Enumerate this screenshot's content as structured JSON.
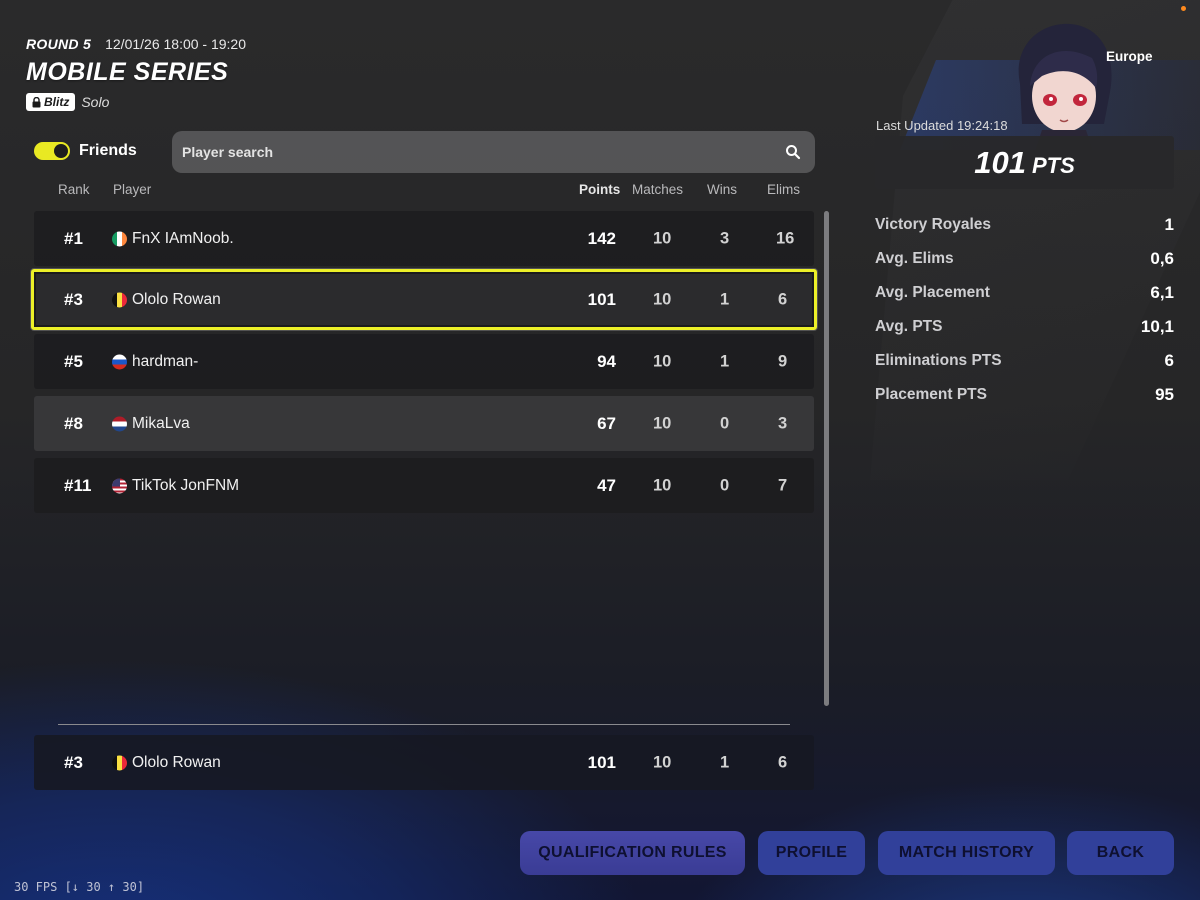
{
  "header": {
    "round": "ROUND 5",
    "time": "12/01/26 18:00 - 19:20",
    "title": "MOBILE SERIES",
    "mode_badge": "Blitz",
    "mode_type": "Solo"
  },
  "filters": {
    "friends_label": "Friends",
    "friends_enabled": true,
    "search_placeholder": "Player search",
    "accent_color": "#e9e923"
  },
  "table": {
    "columns": {
      "rank": "Rank",
      "player": "Player",
      "points": "Points",
      "matches": "Matches",
      "wins": "Wins",
      "elims": "Elims"
    },
    "rows": [
      {
        "rank": "#1",
        "flag": "ireland-flag",
        "name": "FnX IAmNoob.",
        "points": "142",
        "matches": "10",
        "wins": "3",
        "elims": "16"
      },
      {
        "rank": "#3",
        "flag": "belgium-flag",
        "name": "Ololo Rowan",
        "points": "101",
        "matches": "10",
        "wins": "1",
        "elims": "6"
      },
      {
        "rank": "#5",
        "flag": "russia-flag",
        "name": "hardman-",
        "points": "94",
        "matches": "10",
        "wins": "1",
        "elims": "9"
      },
      {
        "rank": "#8",
        "flag": "netherlands-flag",
        "name": "MikaLva",
        "points": "67",
        "matches": "10",
        "wins": "0",
        "elims": "3"
      },
      {
        "rank": "#11",
        "flag": "usa-flag",
        "name": "TikTok JonFNM",
        "points": "47",
        "matches": "10",
        "wins": "0",
        "elims": "7"
      }
    ],
    "self_row": {
      "rank": "#3",
      "flag": "belgium-flag",
      "name": "Ololo Rowan",
      "points": "101",
      "matches": "10",
      "wins": "1",
      "elims": "6"
    }
  },
  "panel": {
    "region": "Europe",
    "last_updated": "Last Updated 19:24:18",
    "points_value": "101",
    "points_unit": "PTS",
    "stats": [
      {
        "label": "Victory Royales",
        "value": "1"
      },
      {
        "label": "Avg. Elims",
        "value": "0,6"
      },
      {
        "label": "Avg. Placement",
        "value": "6,1"
      },
      {
        "label": "Avg. PTS",
        "value": "10,1"
      },
      {
        "label": "Eliminations PTS",
        "value": "6"
      },
      {
        "label": "Placement PTS",
        "value": "95"
      }
    ]
  },
  "buttons": {
    "qualification_rules": "QUALIFICATION RULES",
    "profile": "PROFILE",
    "match_history": "MATCH HISTORY",
    "back": "BACK"
  },
  "fps": "30 FPS [↓ 30 ↑ 30]"
}
